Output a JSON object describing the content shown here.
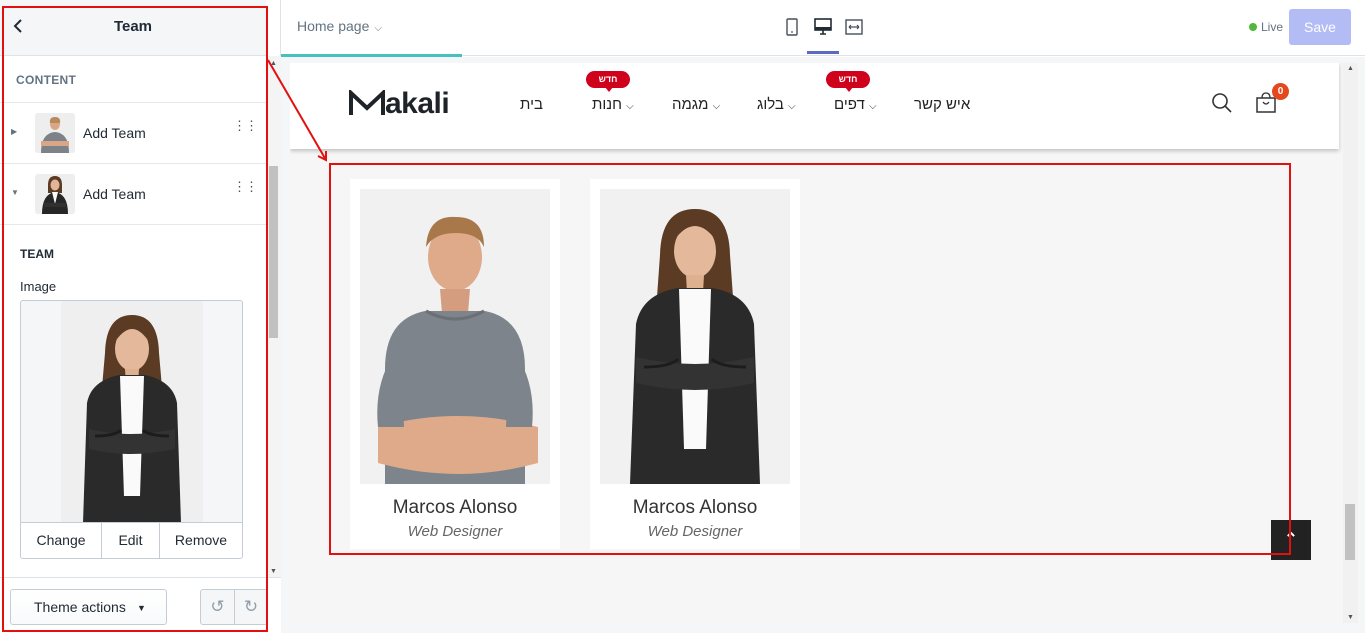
{
  "sidebar": {
    "title": "Team",
    "section_label": "CONTENT",
    "blocks": [
      {
        "label": "Add Team",
        "thumb": "man-photo",
        "expanded": false
      },
      {
        "label": "Add Team",
        "thumb": "woman-photo",
        "expanded": true
      }
    ],
    "block_heading": "TEAM",
    "image_label": "Image",
    "image_actions": [
      "Change",
      "Edit",
      "Remove"
    ],
    "theme_actions_label": "Theme actions",
    "icons": {
      "back": "chevron-left-icon",
      "undo": "undo-icon",
      "redo": "redo-icon",
      "drag": "drag-handle-icon"
    }
  },
  "topbar": {
    "page_select": "Home page",
    "live_label": "Live",
    "save_label": "Save",
    "devices": [
      "mobile-icon",
      "desktop-icon",
      "fullwidth-icon"
    ],
    "active_device": "desktop"
  },
  "store": {
    "logo": "akali",
    "nav": [
      {
        "label": "בית",
        "dropdown": false,
        "badge": ""
      },
      {
        "label": "חנות",
        "dropdown": true,
        "badge": "חדש"
      },
      {
        "label": "מגמה",
        "dropdown": true,
        "badge": ""
      },
      {
        "label": "בלוג",
        "dropdown": true,
        "badge": ""
      },
      {
        "label": "דפים",
        "dropdown": true,
        "badge": "חדש"
      },
      {
        "label": "איש קשר",
        "dropdown": false,
        "badge": ""
      }
    ],
    "cart_count": "0",
    "team": [
      {
        "name": "Marcos Alonso",
        "role": "Web Designer",
        "photo": "man-in-grey-tshirt"
      },
      {
        "name": "Marcos Alonso",
        "role": "Web Designer",
        "photo": "woman-in-black-blazer"
      }
    ]
  },
  "colors": {
    "accent": "#5c6ac4",
    "save_disabled": "#b3bcf5",
    "live": "#50b83c",
    "badge": "#d0021b",
    "annotation": "#e31010",
    "progress": "#47c1bf"
  }
}
